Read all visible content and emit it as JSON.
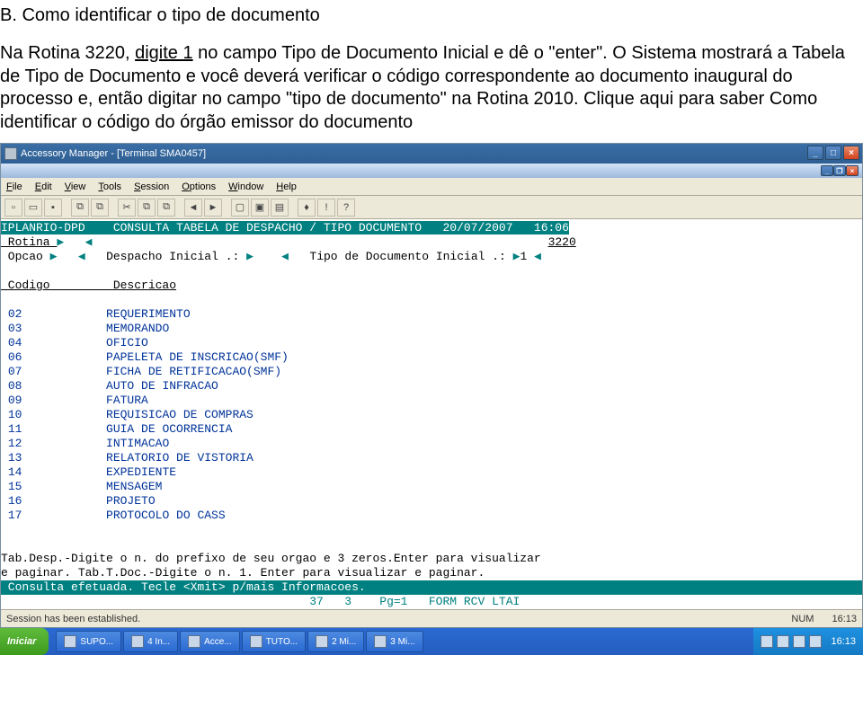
{
  "doc": {
    "heading": "B. Como identificar o tipo de documento",
    "para1_a": "Na Rotina 3220, ",
    "para1_u": "digite 1",
    "para1_b": " no campo Tipo de Documento Inicial e dê o \"enter\". O Sistema mostrará a Tabela de Tipo de Documento e você deverá verificar o código correspondente ao documento inaugural do processo e, então digitar no campo \"tipo de documento\" na Rotina 2010. Clique aqui para saber Como identificar o código do órgão emissor do documento"
  },
  "app": {
    "title": "Accessory Manager - [Terminal SMA0457]",
    "menus": [
      "File",
      "Edit",
      "View",
      "Tools",
      "Session",
      "Options",
      "Window",
      "Help"
    ],
    "tool_icons": [
      "▢",
      "▭",
      "▢",
      "|",
      "▤",
      "▣",
      "|",
      "✂",
      "⧉",
      "⧉",
      "|",
      "⏮",
      "⏭",
      "|",
      "1",
      "2",
      "3",
      "|",
      "♦",
      "!",
      "?"
    ],
    "head_line": "IPLANRIO-DPD    CONSULTA TABELA DE DESPACHO / TIPO DOCUMENTO   20/07/2007   16:06",
    "rotina_lbl": " Rotina ",
    "rotina_val": "3220",
    "opcao_lbl": " Opcao ",
    "despacho_lbl": "Despacho Inicial .: ",
    "tipo_lbl": "Tipo de Documento Inicial .: ",
    "tipo_val": "1",
    "colhead": " Codigo         Descricao",
    "rows": [
      [
        "02",
        "REQUERIMENTO"
      ],
      [
        "03",
        "MEMORANDO"
      ],
      [
        "04",
        "OFICIO"
      ],
      [
        "06",
        "PAPELETA DE INSCRICAO(SMF)"
      ],
      [
        "07",
        "FICHA DE RETIFICACAO(SMF)"
      ],
      [
        "08",
        "AUTO DE INFRACAO"
      ],
      [
        "09",
        "FATURA"
      ],
      [
        "10",
        "REQUISICAO DE COMPRAS"
      ],
      [
        "11",
        "GUIA DE OCORRENCIA"
      ],
      [
        "12",
        "INTIMACAO"
      ],
      [
        "13",
        "RELATORIO DE VISTORIA"
      ],
      [
        "14",
        "EXPEDIENTE"
      ],
      [
        "15",
        "MENSAGEM"
      ],
      [
        "16",
        "PROJETO"
      ],
      [
        "17",
        "PROTOCOLO DO CASS"
      ]
    ],
    "help1": "Tab.Desp.-Digite o n. do prefixo de seu orgao e 3 zeros.Enter para visualizar",
    "help2": "e paginar. Tab.T.Doc.-Digite o n. 1. Enter para visualizar e paginar.",
    "status1": " Consulta efetuada. Tecle <Xmit> p/mais Informacoes.",
    "status2": "                                            37   3    Pg=1   FORM RCV LTAI",
    "statusbar": "Session has been established.",
    "statusbar_r1": "NUM",
    "statusbar_r2": "16:13"
  },
  "task": {
    "start": "Iniciar",
    "items": [
      "SUPO...",
      "4 In...",
      "Acce...",
      "TUTO...",
      "2 Mi...",
      "3 Mi..."
    ],
    "clock": "16:13"
  }
}
